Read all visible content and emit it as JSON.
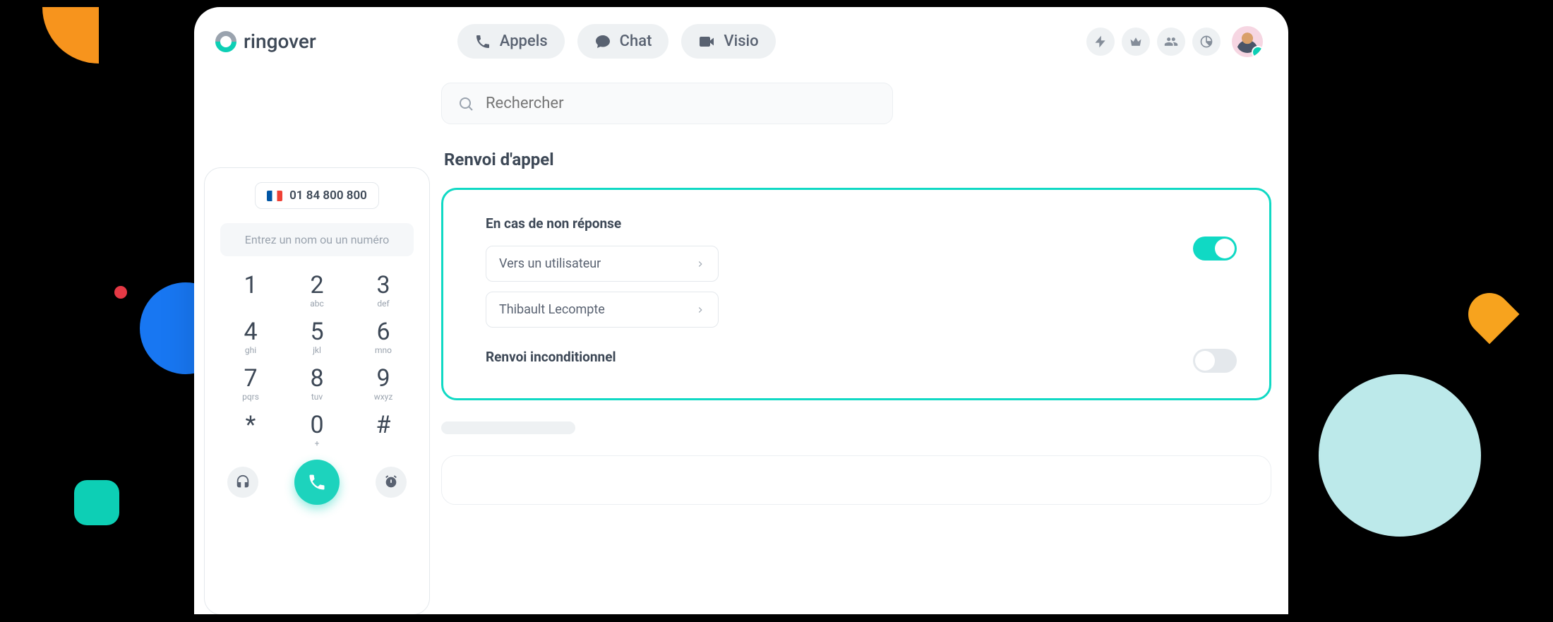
{
  "brand": {
    "name": "ringover"
  },
  "nav": {
    "calls": "Appels",
    "chat": "Chat",
    "video": "Visio"
  },
  "header_icons": [
    "lightning-icon",
    "crown-icon",
    "people-icon",
    "chart-icon"
  ],
  "dialer": {
    "phone_number": "01 84 800 800",
    "input_placeholder": "Entrez un nom ou un numéro",
    "keys": [
      {
        "d": "1",
        "l": ""
      },
      {
        "d": "2",
        "l": "abc"
      },
      {
        "d": "3",
        "l": "def"
      },
      {
        "d": "4",
        "l": "ghi"
      },
      {
        "d": "5",
        "l": "jkl"
      },
      {
        "d": "6",
        "l": "mno"
      },
      {
        "d": "7",
        "l": "pqrs"
      },
      {
        "d": "8",
        "l": "tuv"
      },
      {
        "d": "9",
        "l": "wxyz"
      },
      {
        "d": "*",
        "l": ""
      },
      {
        "d": "0",
        "l": "+"
      },
      {
        "d": "#",
        "l": ""
      }
    ]
  },
  "search": {
    "placeholder": "Rechercher"
  },
  "section": {
    "title": "Renvoi d'appel"
  },
  "no_answer": {
    "title": "En cas de non réponse",
    "target_type": "Vers un utilisateur",
    "target_user": "Thibault Lecompte",
    "enabled": true
  },
  "unconditional": {
    "title": "Renvoi inconditionnel",
    "enabled": false
  },
  "rail_colors": [
    "#bfe8cf",
    "#ffe2c2",
    "#c9e6f6",
    "#f6d1cf",
    "#e8d2ef",
    "#d6f4e2",
    "#fff2c2",
    "#e1d2f8",
    "#d0ede0",
    "#f8d7bd",
    "#dfe4f9",
    "#e7d2f2"
  ]
}
